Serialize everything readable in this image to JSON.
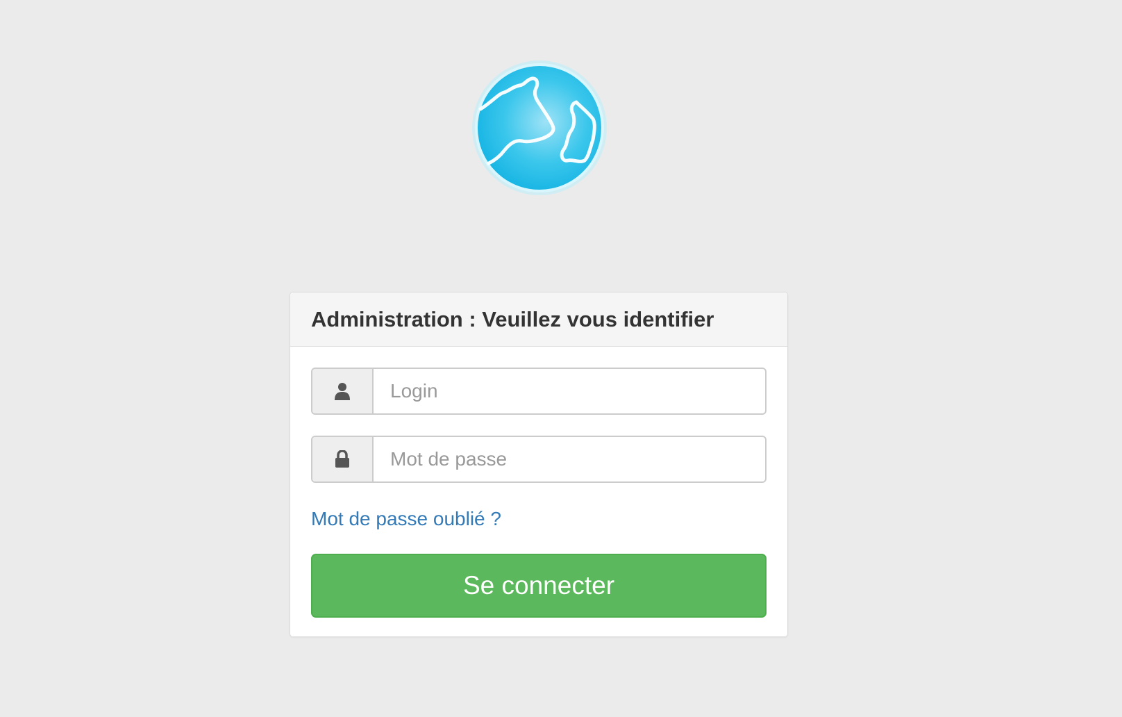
{
  "colors": {
    "background": "#ebebeb",
    "link": "#337ab7",
    "submit_button": "#5cb85c",
    "logo_blue": "#29bfe8"
  },
  "logo": {
    "icon": "globe-logo"
  },
  "panel": {
    "title": "Administration : Veuillez vous identifier"
  },
  "login_field": {
    "icon": "user-icon",
    "placeholder": "Login",
    "value": ""
  },
  "password_field": {
    "icon": "lock-icon",
    "placeholder": "Mot de passe",
    "value": ""
  },
  "forgot_link": "Mot de passe oublié ?",
  "submit_label": "Se connecter"
}
